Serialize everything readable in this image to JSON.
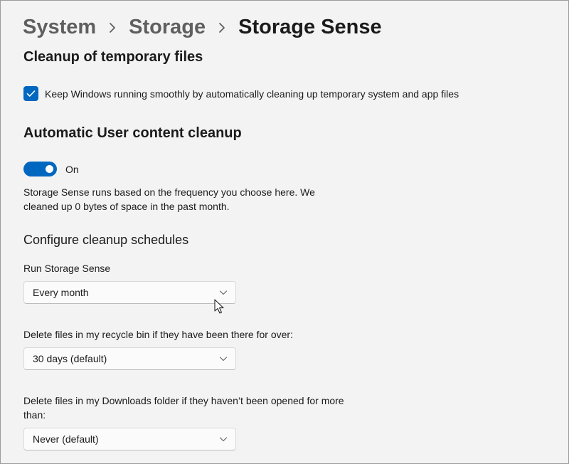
{
  "breadcrumb": {
    "items": [
      "System",
      "Storage",
      "Storage Sense"
    ]
  },
  "temp_cleanup": {
    "title": "Cleanup of temporary files",
    "checkbox_label": "Keep Windows running smoothly by automatically cleaning up temporary system and app files",
    "checked": true
  },
  "user_cleanup": {
    "title": "Automatic User content cleanup",
    "toggle_label": "On",
    "toggle_on": true,
    "description": "Storage Sense runs based on the frequency you choose here. We cleaned up 0 bytes of space in the past month."
  },
  "schedules": {
    "title": "Configure cleanup schedules",
    "run_label": "Run Storage Sense",
    "run_value": "Every month",
    "recycle_label": "Delete files in my recycle bin if they have been there for over:",
    "recycle_value": "30 days (default)",
    "downloads_label": "Delete files in my Downloads folder if they haven’t been opened for more than:",
    "downloads_value": "Never (default)"
  },
  "colors": {
    "accent": "#0067c0",
    "background": "#f3f3f3"
  },
  "icons": {
    "breadcrumb_separator": "chevron-right-icon",
    "checkbox": "checkmark-icon",
    "dropdown": "chevron-down-icon",
    "pointer": "mouse-cursor-icon"
  }
}
